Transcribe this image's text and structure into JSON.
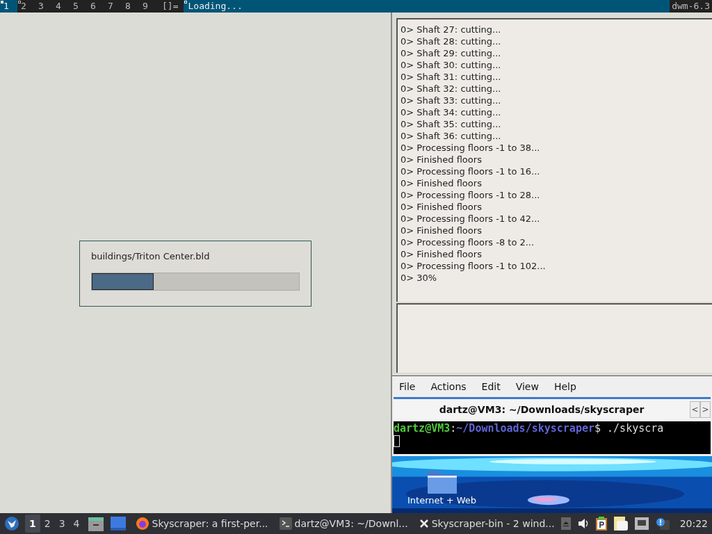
{
  "top_bar": {
    "tags": [
      {
        "label": "1",
        "selected": true,
        "occupied": true
      },
      {
        "label": "2",
        "selected": false,
        "occupied": true
      },
      {
        "label": "3",
        "selected": false,
        "occupied": false
      },
      {
        "label": "4",
        "selected": false,
        "occupied": false
      },
      {
        "label": "5",
        "selected": false,
        "occupied": false
      },
      {
        "label": "6",
        "selected": false,
        "occupied": false
      },
      {
        "label": "7",
        "selected": false,
        "occupied": false
      },
      {
        "label": "8",
        "selected": false,
        "occupied": false
      },
      {
        "label": "9",
        "selected": false,
        "occupied": false
      }
    ],
    "layout": "[]=",
    "title": "Loading...",
    "status": "dwm-6.3"
  },
  "loading_dialog": {
    "file": "buildings/Triton Center.bld",
    "level": 0.3
  },
  "log": {
    "lines": [
      "0> Shaft 27: cutting...",
      "0> Shaft 28: cutting...",
      "0> Shaft 29: cutting...",
      "0> Shaft 30: cutting...",
      "0> Shaft 31: cutting...",
      "0> Shaft 32: cutting...",
      "0> Shaft 33: cutting...",
      "0> Shaft 34: cutting...",
      "0> Shaft 35: cutting...",
      "0> Shaft 36: cutting...",
      "0> Processing floors -1 to 38...",
      "0> Finished floors",
      "0> Processing floors -1 to 16...",
      "0> Finished floors",
      "0> Processing floors -1 to 28...",
      "0> Finished floors",
      "0> Processing floors -1 to 42...",
      "0> Finished floors",
      "0> Processing floors -8 to 2...",
      "0> Finished floors",
      "0> Processing floors -1 to 102...",
      "0> 30%"
    ]
  },
  "terminal": {
    "menu": [
      "File",
      "Actions",
      "Edit",
      "View",
      "Help"
    ],
    "tab_title": "dartz@VM3: ~/Downloads/skyscraper",
    "tab_prev": "<",
    "tab_next": ">",
    "prompt": {
      "user": "dartz@VM3",
      "separator": ":",
      "path": "~/Downloads/skyscraper",
      "symbol": "$",
      "command": "./skyscra"
    }
  },
  "desktop": {
    "icon_label": "Internet + Web"
  },
  "taskbar": {
    "workspaces": [
      {
        "label": "1",
        "selected": true
      },
      {
        "label": "2",
        "selected": false
      },
      {
        "label": "3",
        "selected": false
      },
      {
        "label": "4",
        "selected": false
      }
    ],
    "tasks": [
      {
        "kind": "browser",
        "title": "Skyscraper: a first-per..."
      },
      {
        "kind": "terminal",
        "title": "dartz@VM3: ~/Downl..."
      },
      {
        "kind": "x11",
        "title": "Skyscraper-bin - 2 wind..."
      }
    ],
    "clock": "20:22"
  }
}
